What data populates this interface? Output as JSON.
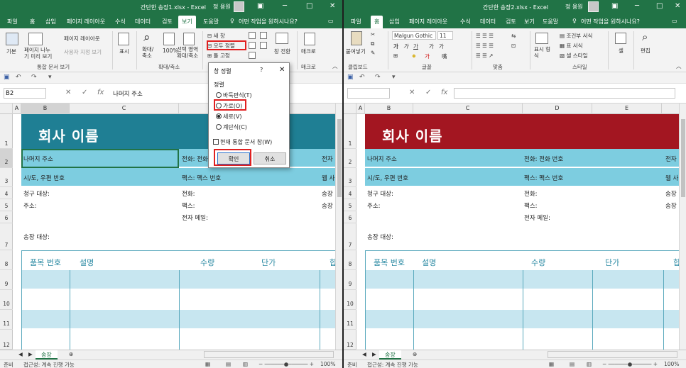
{
  "colors": {
    "excel_green": "#217346",
    "banner_left": "#1f7f94",
    "banner_right": "#a31621",
    "light_row": "#7dcde0",
    "table_fill": "#c7e6f0",
    "highlight_red": "#e02020"
  },
  "left": {
    "title": "간단한 송장1.xlsx  -  Excel",
    "user": "정 용원",
    "name_box": "B2",
    "formula_value": "나머지 주소",
    "tabs": [
      "파일",
      "홈",
      "삽입",
      "페이지 레이아웃",
      "수식",
      "데이터",
      "검토",
      "보기",
      "도움말"
    ],
    "active_tab": "보기",
    "tell_me": "어떤 작업을 원하시나요?",
    "ribbon": {
      "normal": "기본",
      "page_break": "페이지 나누\n기 미리 보기",
      "page_layout": "페이지 레이아웃",
      "custom_views": "사용자 지정 보기",
      "show": "표시",
      "zoom": "확대/\n축소",
      "zoom100": "100%",
      "zoom_sel": "선택 영역\n확대/축소",
      "new_window": "새 창",
      "arrange_all": "모두 정렬",
      "freeze": "틀 고정",
      "switch": "창 전환",
      "macro": "매크로",
      "grp_views": "통합 문서 보기",
      "grp_zoom": "확대/축소",
      "grp_macro": "매크로"
    },
    "columns": [
      "A",
      "B",
      "C"
    ],
    "rows": [
      "1",
      "2",
      "3",
      "4",
      "5",
      "6",
      "7",
      "8",
      "9",
      "10",
      "11",
      "12"
    ],
    "sheet_tab": "송장",
    "status": "준비",
    "accessibility": "접근성: 계속 진행 가능",
    "zoom_level": "100%"
  },
  "right": {
    "title": "간단한 송장2.xlsx  -  Excel",
    "user": "정 용원",
    "tabs": [
      "파일",
      "홈",
      "삽입",
      "페이지 레이아웃",
      "수식",
      "데이터",
      "검토",
      "보기",
      "도움말"
    ],
    "active_tab": "홈",
    "tell_me": "어떤 작업을 원하시나요?",
    "ribbon": {
      "paste": "붙여넣기",
      "font_name": "Malgun Gothic",
      "font_size": "11",
      "cond_format": "조건부 서식",
      "table_format": "표 서식",
      "cell_style": "셀 스타일",
      "number_format": "표시 형\n식",
      "cells": "셀",
      "editing": "편집",
      "grp_clipboard": "클립보드",
      "grp_font": "글꼴",
      "grp_align": "맞춤",
      "grp_style": "스타일"
    },
    "columns": [
      "A",
      "B",
      "C",
      "D",
      "E"
    ],
    "rows": [
      "1",
      "2",
      "3",
      "4",
      "5",
      "6",
      "7",
      "8",
      "9",
      "10",
      "11",
      "12"
    ],
    "sheet_tab": "송장",
    "status": "준비",
    "accessibility": "접근성: 계속 진행 가능",
    "zoom_level": "100%"
  },
  "sheet": {
    "company": "회사 이름",
    "address_rest": "나머지 주소",
    "phone": "전화: 전화 번호",
    "phone_short": "전화: 전화",
    "city": "시/도, 우편 번호",
    "fax": "팩스: 팩스 번호",
    "bill_to": "청구 대상:",
    "addr": "주소:",
    "tel": "전화:",
    "fax_label": "팩스:",
    "email": "전자 메일:",
    "ship_to": "송장 대상:",
    "edge_texts": [
      "전자",
      "웹 사",
      "송장",
      "송장"
    ],
    "headers": [
      "품목 번호",
      "설명",
      "수량",
      "단가",
      "합"
    ]
  },
  "dialog": {
    "title": "창 정렬",
    "help": "?",
    "group": "정렬",
    "options": [
      "바둑판식(T)",
      "가로(O)",
      "세로(V)",
      "계단식(C)"
    ],
    "selected": "세로(V)",
    "checkbox": "현재 통합 문서 창(W)",
    "ok": "확인",
    "cancel": "취소"
  }
}
